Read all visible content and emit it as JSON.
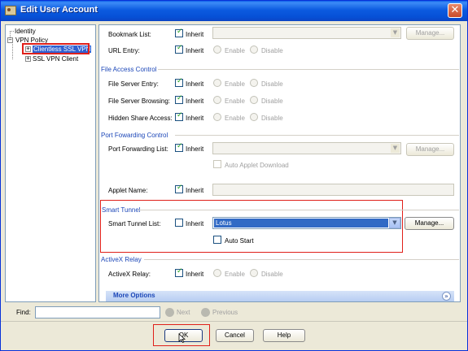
{
  "window": {
    "title": "Edit User Account",
    "close_glyph": "✕"
  },
  "tree": {
    "identity": "Identity",
    "vpn_policy": "VPN Policy",
    "clientless": "Clientless SSL VPN",
    "ssl_client": "SSL VPN Client",
    "expander_plus": "+",
    "expander_minus": "−"
  },
  "form": {
    "inherit": "Inherit",
    "enable": "Enable",
    "disable": "Disable",
    "manage": "Manage...",
    "bookmark_list": "Bookmark List:",
    "url_entry": "URL Entry:",
    "file_access_title": "File Access Control",
    "file_server_entry": "File Server Entry:",
    "file_server_browsing": "File Server Browsing:",
    "hidden_share_access": "Hidden Share Access:",
    "port_forwarding_title": "Port Fowarding Control",
    "port_forwarding_list": "Port Forwarding List:",
    "auto_applet_download": "Auto Applet Download",
    "applet_name": "Applet Name:",
    "smart_tunnel_title": "Smart Tunnel",
    "smart_tunnel_list": "Smart Tunnel List:",
    "smart_tunnel_value": "Lotus",
    "auto_start": "Auto Start",
    "activex_title": "ActiveX Relay",
    "activex_relay": "ActiveX Relay:",
    "more_options": "More Options",
    "more_icon": "»",
    "combo_arrow": "▼"
  },
  "find": {
    "label": "Find:",
    "next": "Next",
    "previous": "Previous",
    "value": ""
  },
  "buttons": {
    "ok": "OK",
    "cancel": "Cancel",
    "help": "Help"
  },
  "colors": {
    "highlight_red": "#e0201a",
    "section_blue": "#1c47b8",
    "title_bar": "#0c5be0"
  }
}
